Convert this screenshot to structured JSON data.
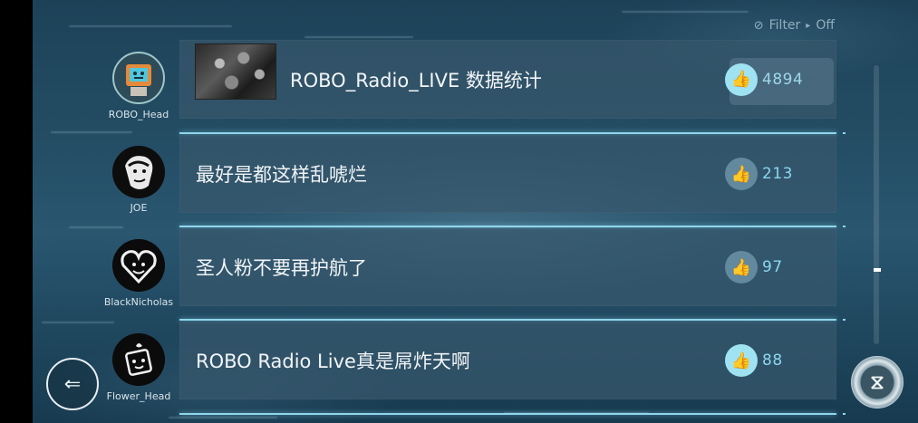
{
  "filter": {
    "label": "Filter",
    "arrow": "▸",
    "state": "Off",
    "icon": "eye-slash-icon"
  },
  "comments": [
    {
      "user": "ROBO_Head",
      "text": "ROBO_Radio_LIVE 数据统计",
      "likes": "4894",
      "liked": true,
      "has_image": true
    },
    {
      "user": "JOE",
      "text": "最好是都这样乱唬烂",
      "likes": "213",
      "liked": false
    },
    {
      "user": "BlackNicholas",
      "text": "圣人粉不要再护航了",
      "likes": "97",
      "liked": false
    },
    {
      "user": "Flower_Head",
      "text": "ROBO Radio Live真是屌炸天啊",
      "likes": "88",
      "liked": true
    }
  ],
  "icons": {
    "like": "thumbs-up-icon",
    "back": "back-arrow-icon",
    "menu": "menu-emblem-icon"
  },
  "colors": {
    "accent": "#8fd6ec",
    "like_active": "#9fe3f3",
    "row_bg": "#37586c"
  }
}
